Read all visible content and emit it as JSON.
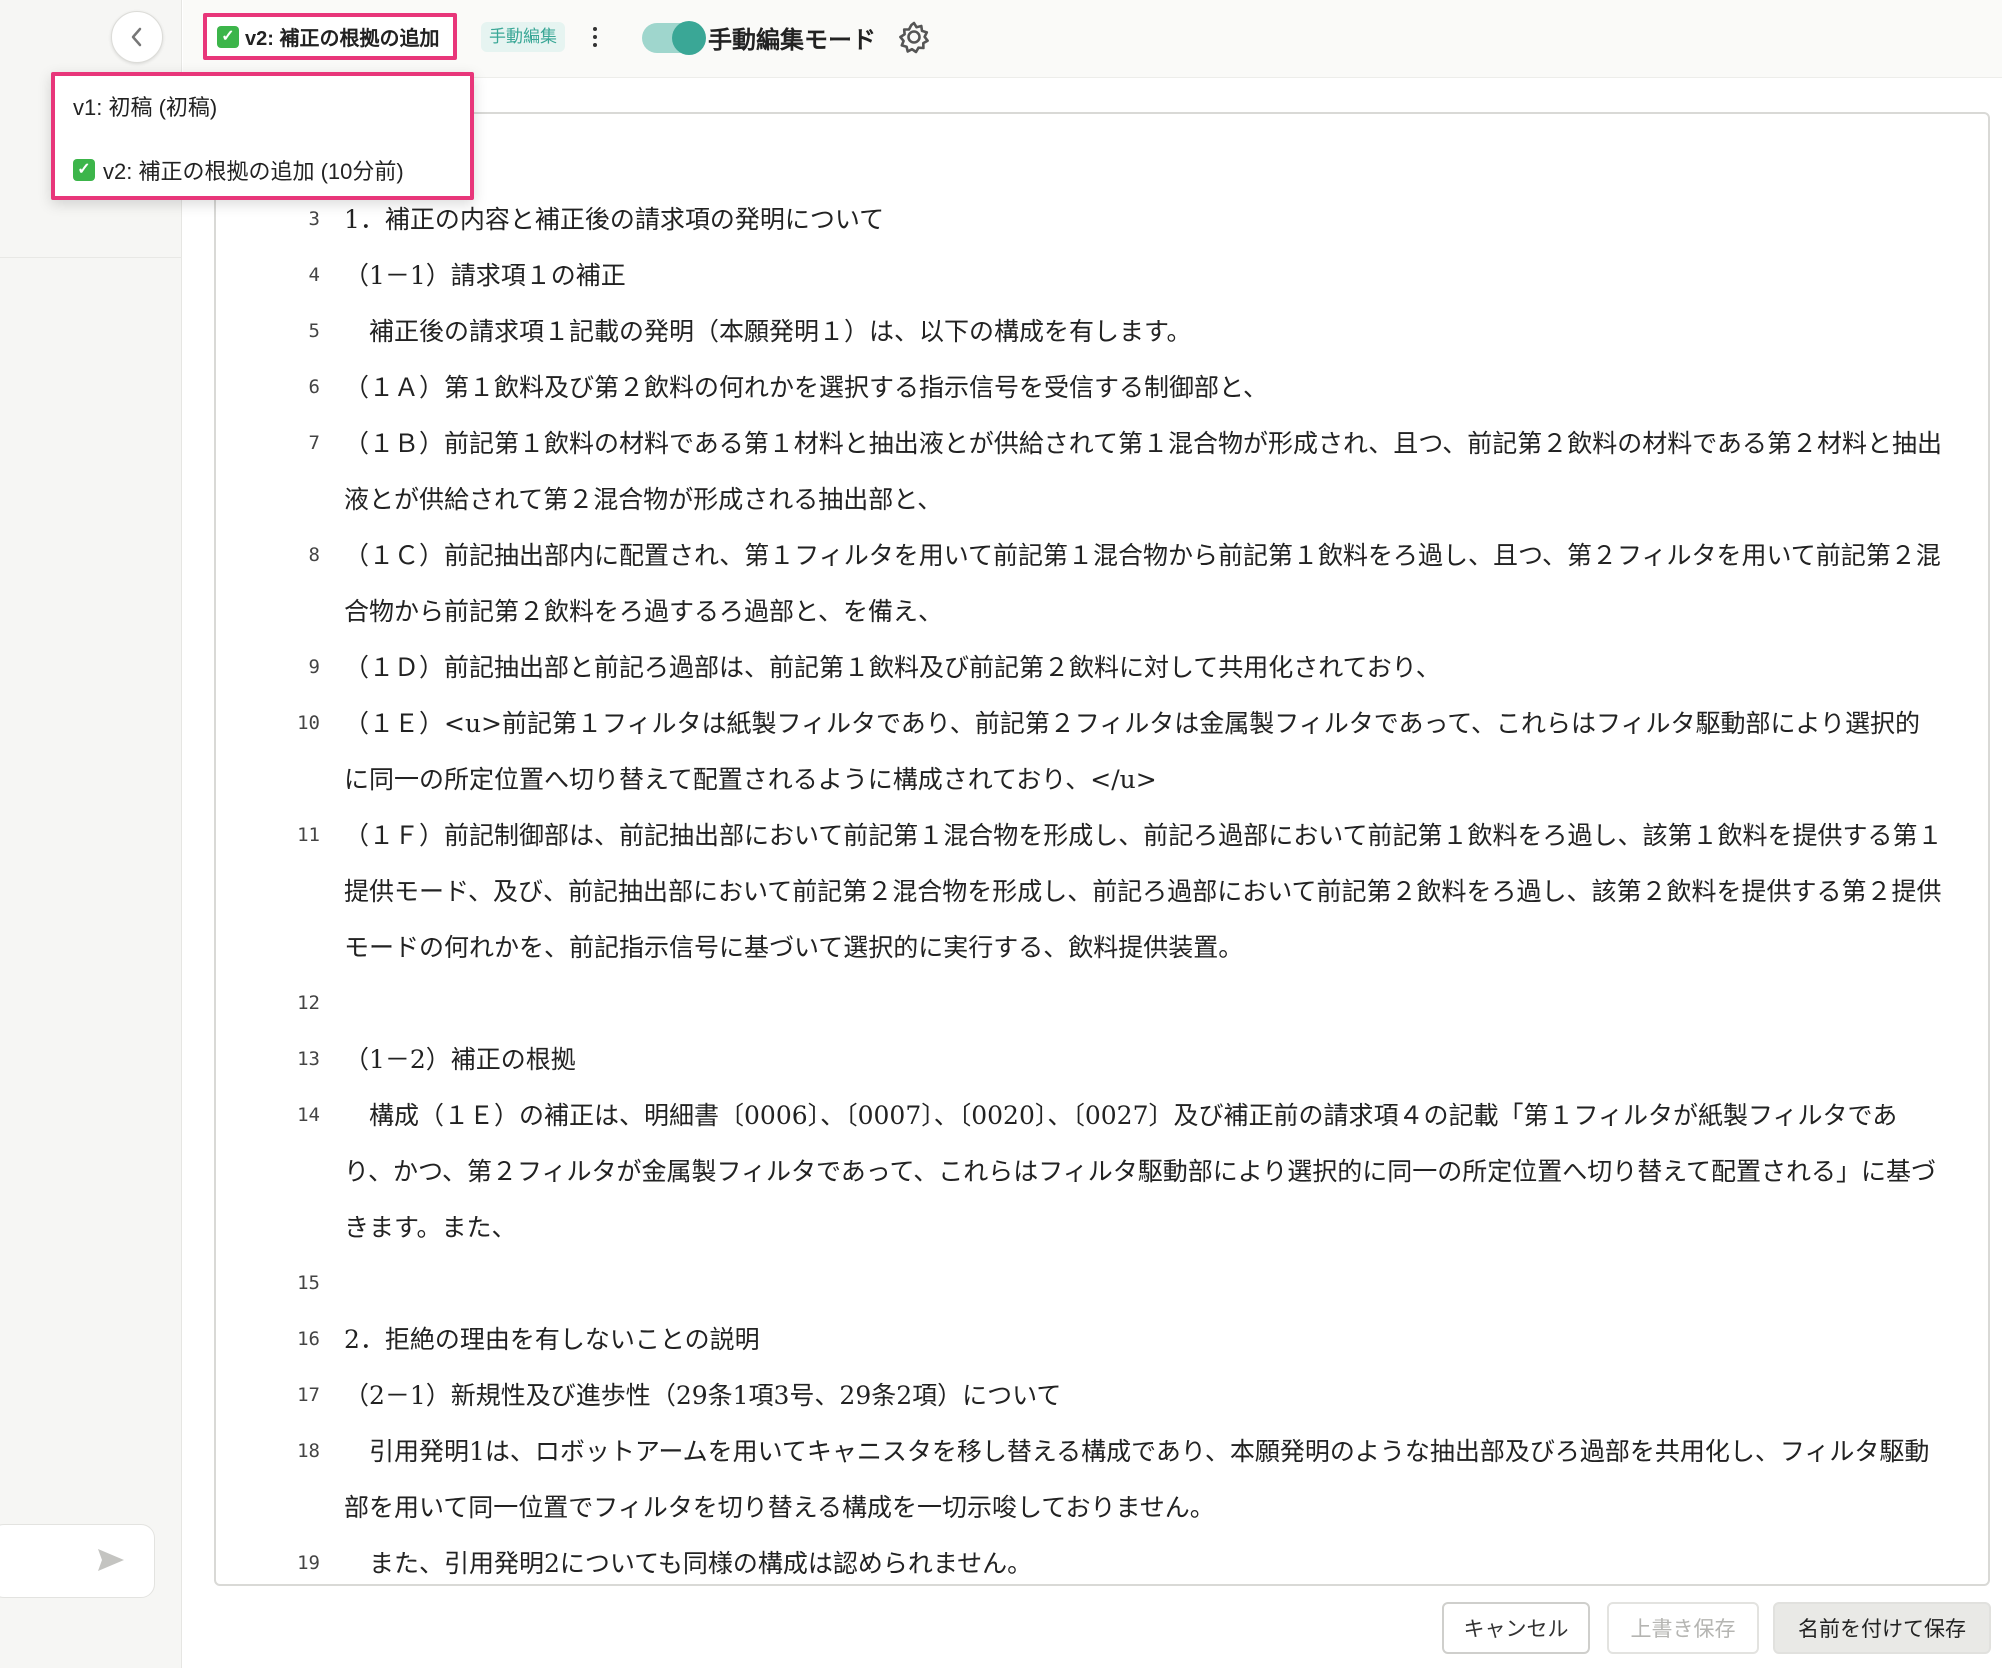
{
  "toolbar": {
    "current_version": "v2: 補正の根拠の追加",
    "manual_tag": "手動編集",
    "toggle_label": "手動編集モード",
    "toggle_on": true
  },
  "version_menu": {
    "items": [
      {
        "label": "v1: 初稿 (初稿)",
        "checked": false
      },
      {
        "label": "v2: 補正の根拠の追加 (10分前)",
        "checked": true
      }
    ]
  },
  "editor": {
    "lines": [
      {
        "num": "3",
        "text": "1．補正の内容と補正後の請求項の発明について"
      },
      {
        "num": "4",
        "text": "（1－1）請求項１の補正"
      },
      {
        "num": "5",
        "text": "　補正後の請求項１記載の発明（本願発明１）は、以下の構成を有します。"
      },
      {
        "num": "6",
        "text": "（１Ａ）第１飲料及び第２飲料の何れかを選択する指示信号を受信する制御部と、"
      },
      {
        "num": "7",
        "text": "（１Ｂ）前記第１飲料の材料である第１材料と抽出液とが供給されて第１混合物が形成され、且つ、前記第２飲料の材料である第２材料と抽出液とが供給されて第２混合物が形成される抽出部と、"
      },
      {
        "num": "8",
        "text": "（１Ｃ）前記抽出部内に配置され、第１フィルタを用いて前記第１混合物から前記第１飲料をろ過し、且つ、第２フィルタを用いて前記第２混合物から前記第２飲料をろ過するろ過部と、を備え、"
      },
      {
        "num": "9",
        "text": "（１Ｄ）前記抽出部と前記ろ過部は、前記第１飲料及び前記第２飲料に対して共用化されており、"
      },
      {
        "num": "10",
        "text": "（１Ｅ）<u>前記第１フィルタは紙製フィルタであり、前記第２フィルタは金属製フィルタであって、これらはフィルタ駆動部により選択的に同一の所定位置へ切り替えて配置されるように構成されており、</u>"
      },
      {
        "num": "11",
        "text": "（１Ｆ）前記制御部は、前記抽出部において前記第１混合物を形成し、前記ろ過部において前記第１飲料をろ過し、該第１飲料を提供する第１提供モード、及び、前記抽出部において前記第２混合物を形成し、前記ろ過部において前記第２飲料をろ過し、該第２飲料を提供する第２提供モードの何れかを、前記指示信号に基づいて選択的に実行する、飲料提供装置。"
      },
      {
        "num": "12",
        "text": ""
      },
      {
        "num": "13",
        "text": "（1－2）補正の根拠"
      },
      {
        "num": "14",
        "text": "　構成（１Ｅ）の補正は、明細書〔0006〕、〔0007〕、〔0020〕、〔0027〕及び補正前の請求項４の記載「第１フィルタが紙製フィルタであり、かつ、第２フィルタが金属製フィルタであって、これらはフィルタ駆動部により選択的に同一の所定位置へ切り替えて配置される」に基づきます。また、"
      },
      {
        "num": "15",
        "text": ""
      },
      {
        "num": "16",
        "text": "2．拒絶の理由を有しないことの説明"
      },
      {
        "num": "17",
        "text": "（2－1）新規性及び進歩性（29条1項3号、29条2項）について"
      },
      {
        "num": "18",
        "text": "　引用発明1は、ロボットアームを用いてキャニスタを移し替える構成であり、本願発明のような抽出部及びろ過部を共用化し、フィルタ駆動部を用いて同一位置でフィルタを切り替える構成を一切示唆しておりません。"
      },
      {
        "num": "19",
        "text": "　また、引用発明2についても同様の構成は認められません。"
      }
    ]
  },
  "footer": {
    "cancel": "キャンセル",
    "overwrite": "上書き保存",
    "save_as": "名前を付けて保存"
  }
}
